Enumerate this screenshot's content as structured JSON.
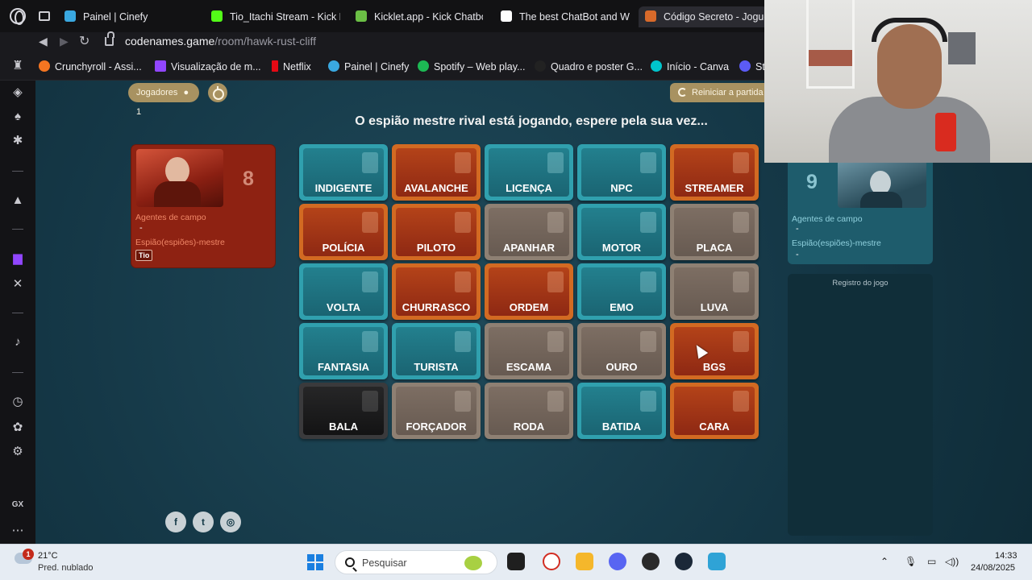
{
  "browser": {
    "tabs": [
      {
        "label": "Painel | Cinefy",
        "color": "#3aa8e0"
      },
      {
        "label": "Tio_Itachi Stream - Kick D",
        "color": "#53fc18"
      },
      {
        "label": "Kicklet.app - Kick Chatbo",
        "color": "#6bbf45"
      },
      {
        "label": "The best ChatBot and Wi",
        "color": "#ffffff"
      },
      {
        "label": "Código Secreto - Jogue",
        "color": "#d86a2a"
      }
    ],
    "url_host": "codenames.game",
    "url_path": "/room/hawk-rust-cliff",
    "bookmarks": [
      {
        "label": "Crunchyroll - Assi...",
        "color": "#f47521"
      },
      {
        "label": "Visualização de m...",
        "color": "#9146ff"
      },
      {
        "label": "Netflix",
        "color": "#e50914"
      },
      {
        "label": "Painel | Cinefy",
        "color": "#3aa8e0"
      },
      {
        "label": "Spotify – Web play...",
        "color": "#1db954"
      },
      {
        "label": "Quadro e poster G...",
        "color": "#222222"
      },
      {
        "label": "Início - Canva",
        "color": "#00c4cc"
      },
      {
        "label": "St",
        "color": "#5b5bf5"
      }
    ]
  },
  "sidebar_icons": [
    "aria-icon",
    "marketplace-icon",
    "crypto-icon",
    "pinboard-icon",
    "twitch-icon",
    "x-icon",
    "music-icon",
    "history-icon",
    "extensions-icon",
    "settings-icon"
  ],
  "game": {
    "players_label": "Jogadores",
    "players_count": "1",
    "restart_label": "Reiniciar a partida",
    "status": "O espião mestre rival está jogando, espere pela sua vez...",
    "red_team": {
      "score": "8",
      "agents_label": "Agentes de campo",
      "agents_value": "-",
      "spymaster_label": "Espião(espiões)-mestre",
      "spymaster_tag": "Tio"
    },
    "blue_team": {
      "score": "9",
      "agents_label": "Agentes de campo",
      "agents_value": "-",
      "spymaster_label": "Espião(espiões)-mestre",
      "spymaster_value": "-"
    },
    "log_title": "Registro do jogo",
    "cards": [
      {
        "word": "INDIGENTE",
        "team": "blue"
      },
      {
        "word": "AVALANCHE",
        "team": "red"
      },
      {
        "word": "LICENÇA",
        "team": "blue"
      },
      {
        "word": "NPC",
        "team": "blue"
      },
      {
        "word": "STREAMER",
        "team": "red"
      },
      {
        "word": "POLÍCIA",
        "team": "red"
      },
      {
        "word": "PILOTO",
        "team": "red"
      },
      {
        "word": "APANHAR",
        "team": "neutral"
      },
      {
        "word": "MOTOR",
        "team": "blue"
      },
      {
        "word": "PLACA",
        "team": "neutral"
      },
      {
        "word": "VOLTA",
        "team": "blue"
      },
      {
        "word": "CHURRASCO",
        "team": "red"
      },
      {
        "word": "ORDEM",
        "team": "red"
      },
      {
        "word": "EMO",
        "team": "blue"
      },
      {
        "word": "LUVA",
        "team": "neutral"
      },
      {
        "word": "FANTASIA",
        "team": "blue"
      },
      {
        "word": "TURISTA",
        "team": "blue"
      },
      {
        "word": "ESCAMA",
        "team": "neutral"
      },
      {
        "word": "OURO",
        "team": "neutral"
      },
      {
        "word": "BGS",
        "team": "red"
      },
      {
        "word": "BALA",
        "team": "black"
      },
      {
        "word": "FORÇADOR",
        "team": "neutral"
      },
      {
        "word": "RODA",
        "team": "neutral"
      },
      {
        "word": "BATIDA",
        "team": "blue"
      },
      {
        "word": "CARA",
        "team": "red"
      }
    ],
    "social": [
      {
        "name": "facebook-icon",
        "glyph": "f"
      },
      {
        "name": "twitter-icon",
        "glyph": "t"
      },
      {
        "name": "instagram-icon",
        "glyph": "◎"
      }
    ]
  },
  "taskbar": {
    "weather_badge": "1",
    "temperature": "21°C",
    "condition": "Pred. nublado",
    "search_placeholder": "Pesquisar",
    "time": "14:33",
    "date": "24/08/2025"
  }
}
